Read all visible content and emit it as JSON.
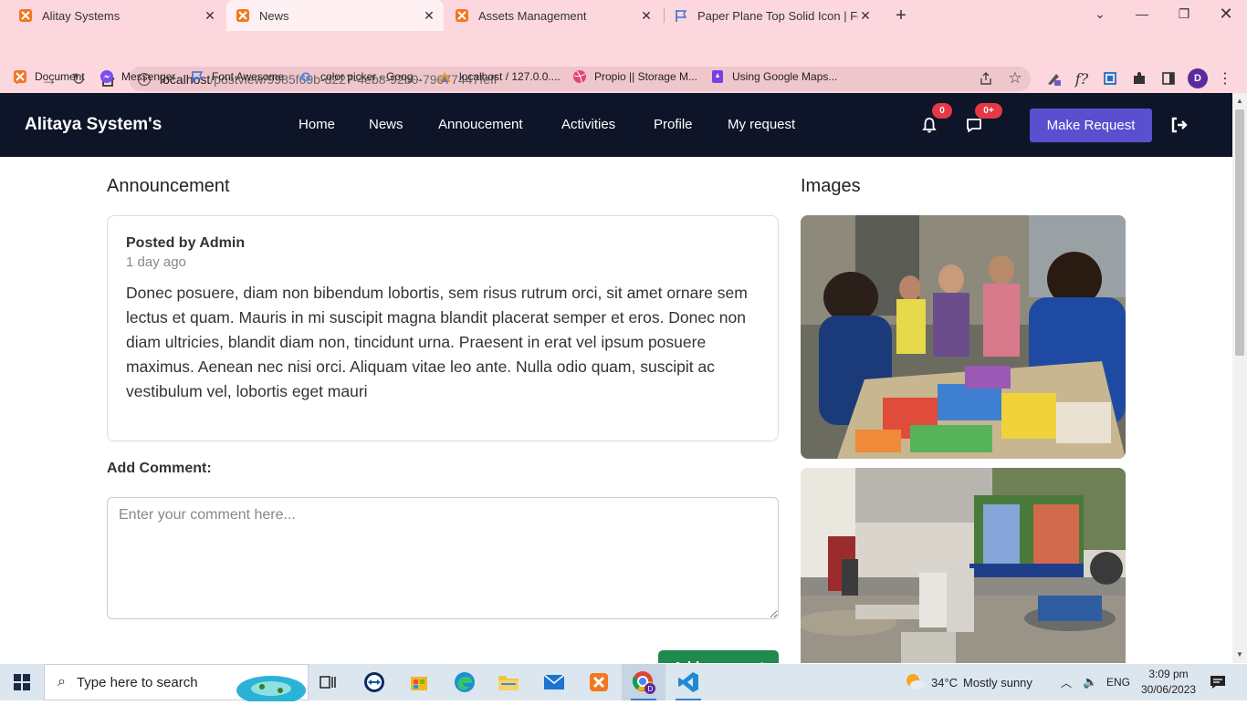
{
  "browser": {
    "tabs": [
      {
        "title": "Alitay Systems",
        "active": false
      },
      {
        "title": "News",
        "active": true
      },
      {
        "title": "Assets Management",
        "active": false
      },
      {
        "title": "Paper Plane Top Solid Icon | Font",
        "active": false
      }
    ],
    "url_host": "localhost",
    "url_path": "/postview/9985f69b-d227-4eb8-92b0-79677447feff",
    "profile_initial": "D",
    "bookmarks": [
      {
        "label": "Document",
        "icon": "xampp-icon"
      },
      {
        "label": "Messenger",
        "icon": "messenger-icon"
      },
      {
        "label": "Font Awesome",
        "icon": "flag-icon"
      },
      {
        "label": "color picker - Goog...",
        "icon": "google-icon"
      },
      {
        "label": "localhost / 127.0.0....",
        "icon": "phpmyadmin-icon"
      },
      {
        "label": "Propio || Storage M...",
        "icon": "dribbble-icon"
      },
      {
        "label": "Using Google Maps...",
        "icon": "bookmark-icon"
      }
    ]
  },
  "site": {
    "brand": "Alitaya System's",
    "nav": [
      "Home",
      "News",
      "Annoucement",
      "Activities",
      "Profile",
      "My request"
    ],
    "notif_count": "0",
    "message_count": "0+",
    "make_request": "Make Request"
  },
  "main": {
    "section_title": "Announcement",
    "posted_by": "Posted by Admin",
    "time_ago": "1 day ago",
    "body": "Donec posuere, diam non bibendum lobortis, sem risus rutrum orci, sit amet ornare sem lectus et quam. Mauris in mi suscipit magna blandit placerat semper et eros. Donec non diam ultricies, blandit diam non, tincidunt urna. Praesent in erat vel ipsum posuere maximus. Aenean nec nisi orci. Aliquam vitae leo ante. Nulla odio quam, suscipit ac vestibulum vel, lobortis eget mauri",
    "add_comment_label": "Add Comment:",
    "comment_placeholder": "Enter your comment here...",
    "add_comment_button": "Add comment"
  },
  "sidebar": {
    "title": "Images"
  },
  "taskbar": {
    "search_placeholder": "Type here to search",
    "weather_temp": "34°C",
    "weather_desc": "Mostly sunny",
    "language": "ENG",
    "time": "3:09 pm",
    "date": "30/06/2023"
  }
}
